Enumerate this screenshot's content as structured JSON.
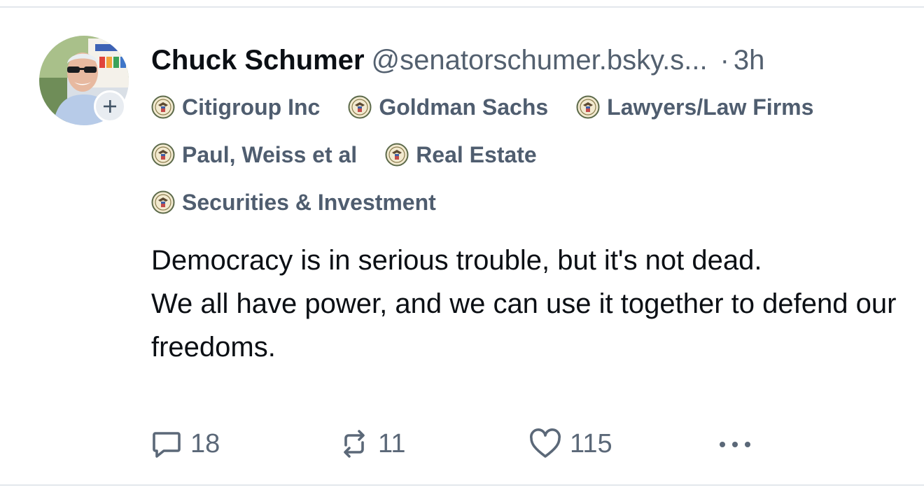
{
  "post": {
    "author": {
      "display_name": "Chuck Schumer",
      "handle": "@senatorschumer.bsky.s...",
      "avatar_icon": "profile-photo",
      "follow_icon": "plus-icon"
    },
    "separator": "·",
    "time_ago": "3h",
    "labels": [
      [
        {
          "text": "Citigroup Inc",
          "icon": "seal-icon"
        },
        {
          "text": "Goldman Sachs",
          "icon": "seal-icon"
        },
        {
          "text": "Lawyers/Law Firms",
          "icon": "seal-icon"
        }
      ],
      [
        {
          "text": "Paul, Weiss et al",
          "icon": "seal-icon"
        },
        {
          "text": "Real Estate",
          "icon": "seal-icon"
        }
      ],
      [
        {
          "text": "Securities & Investment",
          "icon": "seal-icon"
        }
      ]
    ],
    "text_lines": [
      "Democracy is in serious trouble, but it's not dead.",
      "We all have power, and we can use it together to defend our freedoms."
    ],
    "actions": {
      "reply_count": "18",
      "repost_count": "11",
      "like_count": "115",
      "more_icon": "ellipsis-icon"
    }
  },
  "colors": {
    "text_primary": "#0b0f14",
    "text_secondary": "#53606f",
    "label_text": "#4f5d6f",
    "divider": "#e3e7ec",
    "badge_bg": "#e8ecf1"
  }
}
